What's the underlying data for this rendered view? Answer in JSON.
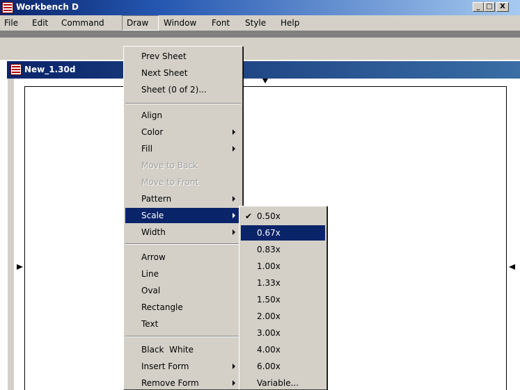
{
  "app": {
    "title": "Workbench D",
    "caption_buttons": {
      "minimize": "_",
      "maximize": "□",
      "close": "X"
    }
  },
  "menubar": [
    {
      "label": "File"
    },
    {
      "label": "Edit"
    },
    {
      "label": "Command"
    },
    {
      "label": "Draw",
      "open": true
    },
    {
      "label": "Window"
    },
    {
      "label": "Font"
    },
    {
      "label": "Style"
    },
    {
      "label": "Help"
    }
  ],
  "document": {
    "title": "New_1.30d"
  },
  "draw_menu": [
    {
      "label": "Prev Sheet"
    },
    {
      "label": "Next Sheet"
    },
    {
      "label": "Sheet (0 of 2)..."
    },
    {
      "separator": true
    },
    {
      "label": "Align"
    },
    {
      "label": "Color",
      "submenu": true
    },
    {
      "label": "Fill",
      "submenu": true
    },
    {
      "label": "Move to Back",
      "disabled": true
    },
    {
      "label": "Move to Front",
      "disabled": true
    },
    {
      "label": "Pattern",
      "submenu": true
    },
    {
      "label": "Scale",
      "submenu": true,
      "highlighted": true
    },
    {
      "label": "Width",
      "submenu": true
    },
    {
      "separator": true
    },
    {
      "label": "Arrow"
    },
    {
      "label": "Line"
    },
    {
      "label": "Oval"
    },
    {
      "label": "Rectangle"
    },
    {
      "label": "Text"
    },
    {
      "separator": true
    },
    {
      "label": "Black  White"
    },
    {
      "label": "Insert Form",
      "submenu": true
    },
    {
      "label": "Remove Form",
      "submenu": true
    }
  ],
  "scale_menu": [
    {
      "label": "0.50x",
      "checked": true
    },
    {
      "label": "0.67x",
      "highlighted": true
    },
    {
      "label": "0.83x"
    },
    {
      "label": "1.00x"
    },
    {
      "label": "1.33x"
    },
    {
      "label": "1.50x"
    },
    {
      "label": "2.00x"
    },
    {
      "label": "3.00x"
    },
    {
      "label": "4.00x"
    },
    {
      "label": "6.00x"
    },
    {
      "label": "Variable..."
    }
  ],
  "checkmark_glyph": "✔"
}
